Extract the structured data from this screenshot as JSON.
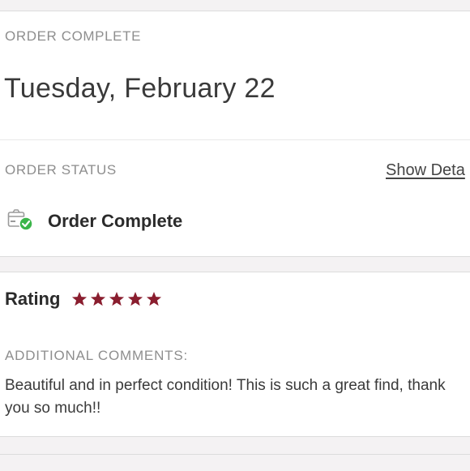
{
  "order": {
    "section_label": "ORDER COMPLETE",
    "date": "Tuesday, February 22"
  },
  "status": {
    "section_label": "ORDER STATUS",
    "details_link": "Show Deta",
    "status_text": "Order Complete",
    "icon": "package-check-icon",
    "check_color": "#3bb54a"
  },
  "rating": {
    "label": "Rating",
    "stars": 5,
    "max_stars": 5,
    "star_color": "#8a1e2f"
  },
  "comments": {
    "label": "ADDITIONAL COMMENTS:",
    "text": "Beautiful and in perfect condition! This is such a great find, thank you so much!!"
  }
}
